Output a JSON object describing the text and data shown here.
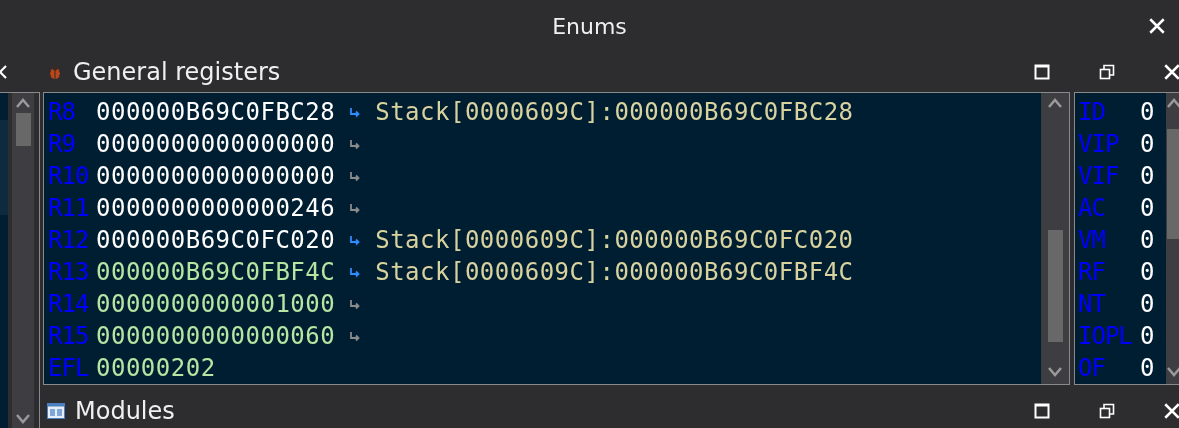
{
  "window": {
    "title": "Enums"
  },
  "registers_panel": {
    "title": "General registers",
    "rows": [
      {
        "kind": "pointer",
        "name": "R8",
        "value": "000000B69C0FBC28",
        "highlighted": false,
        "comment": "Stack[0000609C]:000000B69C0FBC28"
      },
      {
        "kind": "plain",
        "name": "R9",
        "value": "0000000000000000",
        "highlighted": false
      },
      {
        "kind": "plain",
        "name": "R10",
        "value": "0000000000000000",
        "highlighted": false
      },
      {
        "kind": "plain",
        "name": "R11",
        "value": "0000000000000246",
        "highlighted": false
      },
      {
        "kind": "pointer",
        "name": "R12",
        "value": "000000B69C0FC020",
        "highlighted": false,
        "comment": "Stack[0000609C]:000000B69C0FC020"
      },
      {
        "kind": "pointer",
        "name": "R13",
        "value": "000000B69C0FBF4C",
        "highlighted": true,
        "comment": "Stack[0000609C]:000000B69C0FBF4C"
      },
      {
        "kind": "plain",
        "name": "R14",
        "value": "0000000000001000",
        "highlighted": true
      },
      {
        "kind": "plain",
        "name": "R15",
        "value": "0000000000000060",
        "highlighted": true
      },
      {
        "kind": "flags",
        "name": "EFL",
        "value": "00000202",
        "highlighted": true
      }
    ]
  },
  "flags": [
    {
      "name": "ID",
      "value": "0"
    },
    {
      "name": "VIP",
      "value": "0"
    },
    {
      "name": "VIF",
      "value": "0"
    },
    {
      "name": "AC",
      "value": "0"
    },
    {
      "name": "VM",
      "value": "0"
    },
    {
      "name": "RF",
      "value": "0"
    },
    {
      "name": "NT",
      "value": "0"
    },
    {
      "name": "IOPL",
      "value": "0"
    },
    {
      "name": "OF",
      "value": "0"
    }
  ],
  "modules_panel": {
    "title": "Modules"
  }
}
